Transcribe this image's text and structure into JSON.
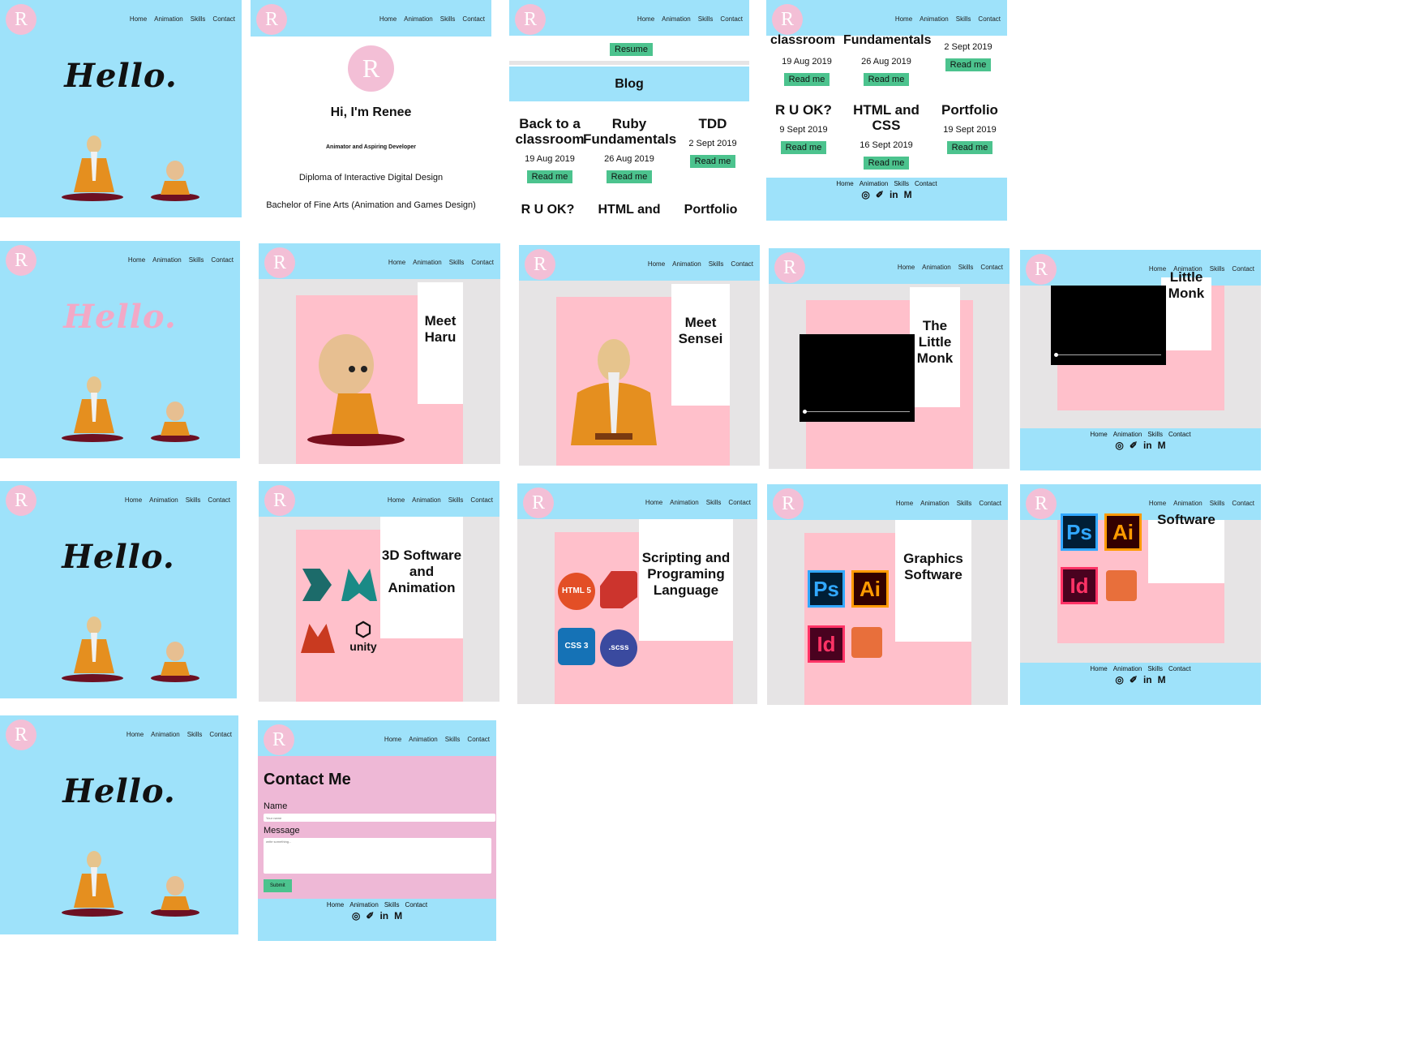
{
  "nav": {
    "logo": "R",
    "links": [
      "Home",
      "Animation",
      "Skills",
      "Contact"
    ]
  },
  "hello": "Hello.",
  "profile": {
    "greeting": "Hi, I'm Renee",
    "role": "Animator and Aspiring Developer",
    "edu1": "Diploma of Interactive Digital Design",
    "edu2": "Bachelor of Fine Arts (Animation and Games Design)"
  },
  "resume_button": "Resume",
  "blog": {
    "title": "Blog",
    "read_label": "Read me",
    "posts": [
      {
        "title": "Back to a classroom",
        "date": "19 Aug 2019"
      },
      {
        "title": "Ruby Fundamentals",
        "date": "26 Aug 2019"
      },
      {
        "title": "TDD",
        "date": "2 Sept 2019"
      },
      {
        "title": "R U OK?",
        "date": "9 Sept 2019"
      },
      {
        "title": "HTML and CSS",
        "date": "16 Sept 2019"
      },
      {
        "title": "Portfolio",
        "date": "19 Sept 2019"
      }
    ],
    "scroll_top_titles": [
      "classroom",
      "Fundamentals"
    ],
    "cut_titles": [
      "R U OK?",
      "HTML and",
      "Portfolio"
    ]
  },
  "footer": {
    "icons": [
      "github-icon",
      "twitter-icon",
      "linkedin-icon",
      "medium-icon"
    ],
    "icon_glyphs": [
      "◎",
      "✐",
      "in",
      "M"
    ]
  },
  "animation": {
    "haru": "Meet Haru",
    "sensei": "Meet Sensei",
    "monk": "The Little Monk",
    "monk_cut": "Monk",
    "monk_cut_top": "Little"
  },
  "skills": {
    "software3d": "3D Software and Animation",
    "scripting": "Scripting and Programing Language",
    "graphics": "Graphics Software",
    "graphics_cut": "Software",
    "unity": "unity",
    "scss": ".scss",
    "html5": "HTML 5",
    "css3": "CSS 3",
    "ps": "Ps",
    "ai": "Ai",
    "id": "Id"
  },
  "contact": {
    "title": "Contact Me",
    "name_label": "Name",
    "name_placeholder": "Your name",
    "message_label": "Message",
    "message_placeholder": "write something...",
    "submit": "Submit"
  },
  "colors": {
    "sky": "#9ee2fa",
    "pink_panel": "#ffc0cb",
    "logo_pink": "#f3bfd6",
    "button_green": "#4cc38e",
    "contact_bg": "#eeb8d6"
  }
}
